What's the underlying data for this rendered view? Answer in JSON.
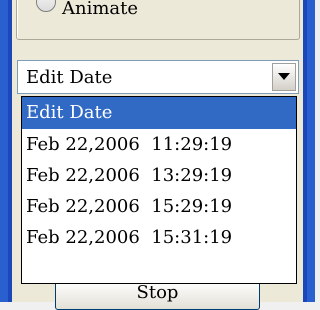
{
  "animate_option": {
    "label": "Animate",
    "selected": false
  },
  "date_select": {
    "value": "Edit Date",
    "options": [
      "Edit Date",
      "Feb 22,2006  11:29:19",
      "Feb 22,2006  13:29:19",
      "Feb 22,2006  15:29:19",
      "Feb 22,2006  15:31:19"
    ],
    "highlighted_index": 0
  },
  "bottom_button": {
    "label": "Stop"
  },
  "colors": {
    "highlight": "#316ac5",
    "frame_blue": "#2a5fd0",
    "panel_bg": "#ece9d8"
  }
}
